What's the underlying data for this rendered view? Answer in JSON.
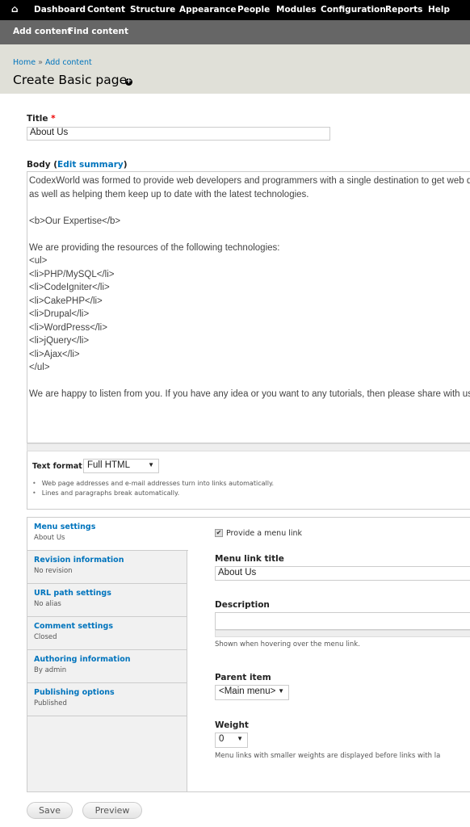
{
  "toolbar": {
    "items": [
      "Dashboard",
      "Content",
      "Structure",
      "Appearance",
      "People",
      "Modules",
      "Configuration",
      "Reports",
      "Help"
    ]
  },
  "shortcuts": [
    "Add content",
    "Find content"
  ],
  "breadcrumb": {
    "home": "Home",
    "separator": "»",
    "current": "Add content"
  },
  "page_title": "Create Basic page",
  "title_field": {
    "label": "Title",
    "required": "*",
    "value": "About Us"
  },
  "body_field": {
    "label": "Body",
    "edit_summary": "Edit summary",
    "lines": [
      "CodexWorld was formed to provide web developers and programmers with a single destination to get web developm",
      "as well as helping them keep up to date with the latest technologies.",
      "",
      "<b>Our Expertise</b>",
      "",
      "We are providing the resources of the following technologies:",
      "<ul>",
      "<li>PHP/MySQL</li>",
      "<li>CodeIgniter</li>",
      "<li>CakePHP</li>",
      "<li>Drupal</li>",
      "<li>WordPress</li>",
      "<li>jQuery</li>",
      "<li>Ajax</li>",
      "</ul>",
      "",
      "We are happy to listen from you. If you have any idea or you want to any tutorials, then please share with us.we w"
    ]
  },
  "text_format": {
    "label": "Text format",
    "value": "Full HTML",
    "tips": [
      "Web page addresses and e-mail addresses turn into links automatically.",
      "Lines and paragraphs break automatically."
    ]
  },
  "vertical_tabs": [
    {
      "title": "Menu settings",
      "summary": "About Us"
    },
    {
      "title": "Revision information",
      "summary": "No revision"
    },
    {
      "title": "URL path settings",
      "summary": "No alias"
    },
    {
      "title": "Comment settings",
      "summary": "Closed"
    },
    {
      "title": "Authoring information",
      "summary": "By admin"
    },
    {
      "title": "Publishing options",
      "summary": "Published"
    }
  ],
  "menu_settings": {
    "provide_link_label": "Provide a menu link",
    "provide_link_checked": true,
    "link_title_label": "Menu link title",
    "link_title_value": "About Us",
    "description_label": "Description",
    "description_value": "",
    "description_help": "Shown when hovering over the menu link.",
    "parent_label": "Parent item",
    "parent_value": "<Main menu>",
    "weight_label": "Weight",
    "weight_value": "0",
    "weight_help": "Menu links with smaller weights are displayed before links with la"
  },
  "actions": {
    "save": "Save",
    "preview": "Preview"
  }
}
